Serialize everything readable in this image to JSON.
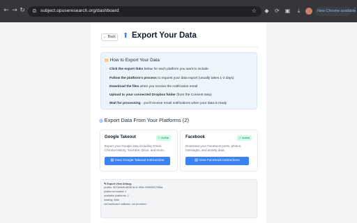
{
  "browser": {
    "url": "subject.opuseresearch.org/dashboard",
    "new_chrome_label": "New Chrome available"
  },
  "header": {
    "back_label": "← Back",
    "title": "Export Your Data"
  },
  "howto": {
    "title": "How to Export Your Data",
    "steps": [
      {
        "bold": "Click the export links",
        "rest": " below for each platform you want to include"
      },
      {
        "bold": "Follow the platform's process",
        "rest": " to request your data export (usually takes 1-3 days)"
      },
      {
        "bold": "Download the files",
        "rest": " when you receive the notification email"
      },
      {
        "bold": "Upload to your connected Dropbox folder",
        "rest": " (from the Consent step)"
      },
      {
        "bold": "Wait for processing",
        "rest": " - you'll receive email notifications when your data is ready"
      }
    ]
  },
  "platforms_section": {
    "title": "Export Data From Your Platforms (2)"
  },
  "platforms": [
    {
      "name": "Google Takeout",
      "status": "Active",
      "description": "Export your Google data including Gmail, Chrome history, YouTube, Drive, and more.",
      "button_label": "View Google Takeout Instructions"
    },
    {
      "name": "Facebook",
      "status": "Active",
      "description": "Download your Facebook posts, photos, messages, and activity data.",
      "button_label": "View Facebook Instructions"
    }
  ],
  "debug": {
    "title": "Export View Debug:",
    "lines": [
      "prolific: 5673a5d5-8838-4c11-9f8e-20959817055a",
      "platforms loaded: 2",
      "available platforms: 2",
      "loading: false",
      "onDashboard callback: not provided"
    ]
  },
  "colors": {
    "accent": "#3b82f6",
    "active_badge_bg": "#d1fae5",
    "active_badge_text": "#047857",
    "howto_bg": "#eef4fb"
  }
}
